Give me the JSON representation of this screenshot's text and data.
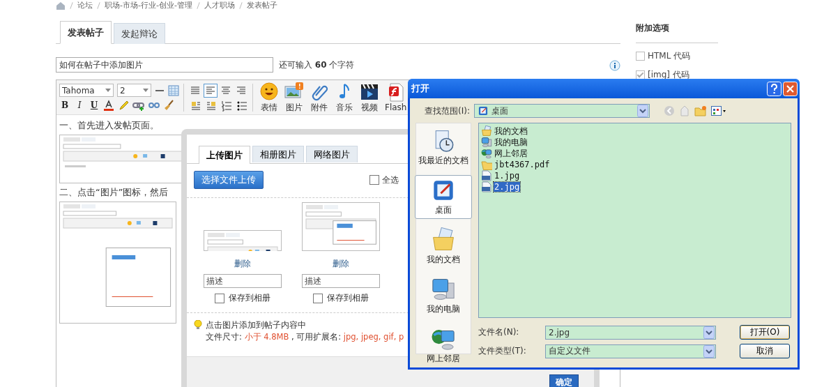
{
  "breadcrumb": [
    "论坛",
    "职场-市场-行业-创业-管理",
    "人才职场",
    "发表帖子"
  ],
  "tabs": [
    {
      "label": "发表帖子",
      "selected": true
    },
    {
      "label": "发起辩论",
      "selected": false
    }
  ],
  "subject": {
    "value": "如何在帖子中添加图片",
    "counter": "还可输入 **60** 个字符"
  },
  "toolbar": {
    "font": "Tahoma",
    "size": "2",
    "format_buttons": [
      "B",
      "I",
      "U"
    ],
    "align_buttons": [
      {
        "selected": false
      },
      {
        "selected": true
      },
      {
        "selected": false
      },
      {
        "selected": false
      }
    ],
    "media_buttons": [
      {
        "label": "表情",
        "kind": "emoji"
      },
      {
        "label": "图片",
        "kind": "image"
      },
      {
        "label": "附件",
        "kind": "attachment"
      },
      {
        "label": "音乐",
        "kind": "music"
      },
      {
        "label": "视频",
        "kind": "video"
      },
      {
        "label": "Flash",
        "kind": "flash"
      }
    ]
  },
  "content": [
    {
      "kind": "text",
      "text": "一、首先进入发帖页面。"
    },
    {
      "kind": "screenshot"
    },
    {
      "kind": "text",
      "text": "二、点击“图片”图标，然后"
    },
    {
      "kind": "screenshot"
    }
  ],
  "sidebar": {
    "title": "附加选项",
    "options": [
      {
        "label": "HTML 代码",
        "checked": false
      },
      {
        "label": "[img] 代码",
        "checked": true
      }
    ]
  },
  "upload_dialog": {
    "tabs": [
      {
        "label": "上传图片",
        "selected": true
      },
      {
        "label": "相册图片",
        "selected": false
      },
      {
        "label": "网络图片",
        "selected": false
      }
    ],
    "upload_button": "选择文件上传",
    "select_all": {
      "label": "全选",
      "checked": false
    },
    "images": [
      {
        "kind": "toolbar",
        "delete": "删除",
        "placeholder": "描述",
        "save_label": "保存到相册",
        "checked": false
      },
      {
        "kind": "dialog",
        "delete": "删除",
        "placeholder": "描述",
        "save_label": "保存到相册",
        "checked": false
      }
    ],
    "tip": "点击图片添加到帖子内容中",
    "file_info": [
      {
        "text": "文件尺寸: ",
        "highlight": false
      },
      {
        "text": "小于 4.8MB",
        "highlight": true
      },
      {
        "text": " , 可用扩展名: ",
        "highlight": false
      },
      {
        "text": "jpg, jpeg, gif, p",
        "highlight": true
      }
    ],
    "ok_button": "确定"
  },
  "open_dialog": {
    "title": "打开",
    "look_in_label": "查找范围(I):",
    "look_in": "桌面",
    "places": [
      {
        "label": "我最近的文档",
        "kind": "recent",
        "selected": false
      },
      {
        "label": "桌面",
        "kind": "desktop",
        "selected": true
      },
      {
        "label": "我的文档",
        "kind": "documents",
        "selected": false
      },
      {
        "label": "我的电脑",
        "kind": "computer",
        "selected": false
      },
      {
        "label": "网上邻居",
        "kind": "network",
        "selected": false
      }
    ],
    "files": [
      {
        "name": "我的文档",
        "kind": "documents",
        "selected": false
      },
      {
        "name": "我的电脑",
        "kind": "computer",
        "selected": false
      },
      {
        "name": "网上邻居",
        "kind": "network",
        "selected": false
      },
      {
        "name": "jbt4367.pdf",
        "kind": "folder",
        "selected": false
      },
      {
        "name": "1.jpg",
        "kind": "jpg",
        "selected": false
      },
      {
        "name": "2.jpg",
        "kind": "jpg",
        "selected": true
      }
    ],
    "filename_label": "文件名(N):",
    "filename": "2.jpg",
    "filetype_label": "文件类型(T):",
    "filetype": "自定义文件",
    "buttons": [
      "打开(O)",
      "取消"
    ]
  }
}
